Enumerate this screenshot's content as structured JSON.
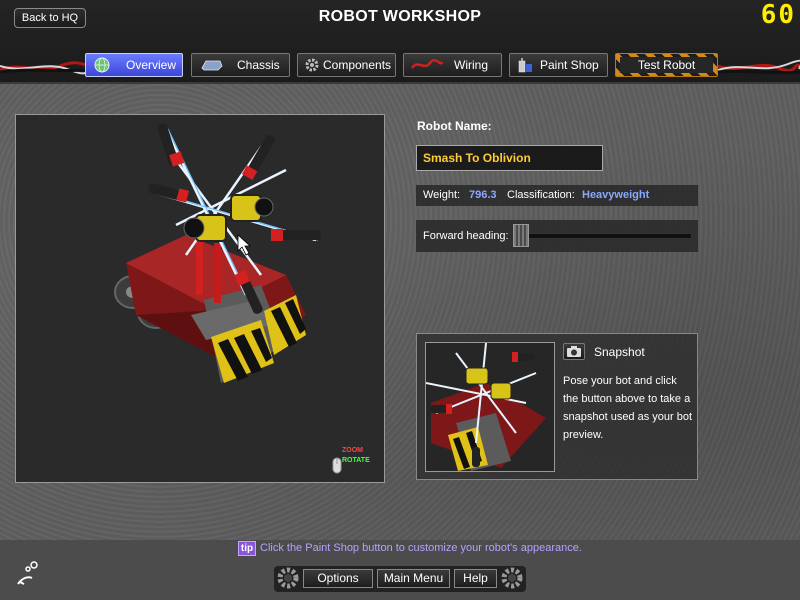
{
  "header": {
    "back_label": "Back to HQ",
    "title": "ROBOT WORKSHOP",
    "fps": "60"
  },
  "tabs": [
    {
      "label": "Overview",
      "icon": "globe-icon",
      "active": true
    },
    {
      "label": "Chassis",
      "icon": "chassis-icon",
      "active": false
    },
    {
      "label": "Components",
      "icon": "gear-icon",
      "active": false
    },
    {
      "label": "Wiring",
      "icon": "wire-icon",
      "active": false
    },
    {
      "label": "Paint Shop",
      "icon": "paint-can-icon",
      "active": false
    },
    {
      "label": "Test Robot",
      "icon": "",
      "active": false
    }
  ],
  "viewport": {
    "zoom_label": "ZOOM",
    "rotate_label": "ROTATE"
  },
  "robot": {
    "name_label": "Robot Name:",
    "name_value": "Smash To Oblivion",
    "weight_label": "Weight:",
    "weight_value": "796.3",
    "class_label": "Classification:",
    "class_value": "Heavyweight",
    "heading_label": "Forward heading:",
    "heading_fraction": 0.0
  },
  "snapshot": {
    "title": "Snapshot",
    "description": "Pose your bot and click the button above to take a snapshot used as your bot preview."
  },
  "footer": {
    "tip_badge": "tip",
    "tip_text": "Click the Paint Shop button to customize your robot's appearance.",
    "options_label": "Options",
    "main_menu_label": "Main Menu",
    "help_label": "Help"
  },
  "colors": {
    "accent_blue": "#4f5ae8",
    "name_yellow": "#ffcc33",
    "value_blue": "#8aa8ff",
    "fps_yellow": "#ffee00",
    "tip_purple": "#8a55d8"
  }
}
